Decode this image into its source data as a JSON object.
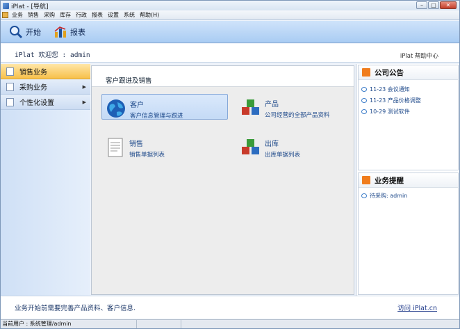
{
  "window": {
    "title": "iPlat - [导航]"
  },
  "menu": [
    "业务",
    "销售",
    "采购",
    "库存",
    "行政",
    "报表",
    "设置",
    "系统",
    "帮助(H)"
  ],
  "toolbar": {
    "start_label": "开始",
    "report_label": "报表"
  },
  "header": {
    "welcome": "iPlat 欢迎您 : admin",
    "help": "iPlat 帮助中心"
  },
  "sidebar": {
    "items": [
      {
        "label": "销售业务",
        "active": true
      },
      {
        "label": "采购业务",
        "arrow": "▶"
      },
      {
        "label": "个性化设置",
        "arrow": "▶"
      }
    ]
  },
  "main": {
    "title": "客户跟进及销售",
    "cards": [
      {
        "title": "客户",
        "desc": "客户信息管理与跟进",
        "icon": "globe-icon"
      },
      {
        "title": "产品",
        "desc": "公司经营的全部产品资料",
        "icon": "cubes-icon"
      },
      {
        "title": "销售",
        "desc": "销售单据列表",
        "icon": "document-icon"
      },
      {
        "title": "出库",
        "desc": "出库单据列表",
        "icon": "cubes-icon"
      }
    ]
  },
  "announcements": {
    "title": "公司公告",
    "items": [
      "11-23 会议通知",
      "11-23 产品价格调整",
      "10-29 测试软件"
    ]
  },
  "reminders": {
    "title": "业务提醒",
    "items": [
      "待采购: admin"
    ]
  },
  "footer": {
    "message": "业务开始前需要完善产品资料、客户信息.",
    "link": "访问 iPlat.cn"
  },
  "status": {
    "user": "当前用户 : 系统管理/admin"
  },
  "colors": {
    "accent": "#f7c04a",
    "toolbar": "#bcd7f6",
    "link": "#1f4a8b"
  }
}
